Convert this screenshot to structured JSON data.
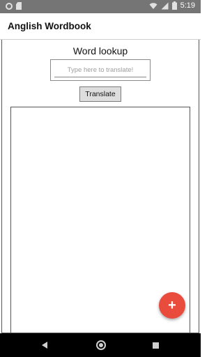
{
  "status_bar": {
    "time": "5:19",
    "icons": [
      "circle-notification-icon",
      "sd-card-icon",
      "wifi-icon",
      "cell-signal-icon",
      "battery-icon"
    ]
  },
  "app_bar": {
    "title": "Anglish Wordbook"
  },
  "main": {
    "lookup_title": "Word lookup",
    "search": {
      "value": "",
      "placeholder": "Type here to translate!"
    },
    "translate_label": "Translate",
    "result_text": ""
  },
  "fab": {
    "icon": "plus-icon",
    "label": "+",
    "color": "#e94b3c"
  },
  "nav_bar": {
    "icons": [
      "back-icon",
      "home-icon",
      "recents-icon"
    ]
  }
}
